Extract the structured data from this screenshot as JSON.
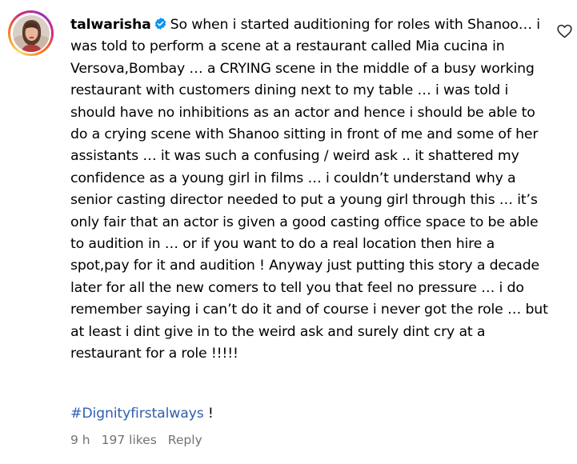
{
  "comment": {
    "username": "talwarisha",
    "verified": true,
    "text": "So when i started auditioning for roles with Shanoo… i was told to perform a scene at a restaurant called Mia cucina in Versova,Bombay … a CRYING scene in the middle of a busy working restaurant with customers dining next to my table … i was told i should have no inhibitions as an actor and hence i should be able to do a crying scene with Shanoo sitting in front of me and some of her assistants … it was such a confusing / weird ask .. it shattered my confidence as a young girl in films … i couldn’t understand why a senior casting director needed to put a young girl through this … it’s only fair that an actor is given a good casting office space to be able to audition in … or if you want to do a real location then hire a spot,pay for it and audition ! Anyway just putting this story a decade later for all the new comers to tell you that feel no pressure … i do remember saying i can’t do it and of course i never got the role … but at least i dint give in to the weird ask and surely dint cry at a restaurant for a role !!!!!",
    "hashtag": "#Dignityfirstalways",
    "hashtag_suffix": " !",
    "time": "9 h",
    "likes": "197 likes",
    "reply_label": "Reply"
  },
  "icons": {
    "avatar": "profile-avatar",
    "verified": "verified-badge-icon",
    "like": "heart-outline-icon"
  },
  "colors": {
    "hashtag": "#2f5fb0",
    "meta": "#737373",
    "verified": "#0095f6"
  }
}
